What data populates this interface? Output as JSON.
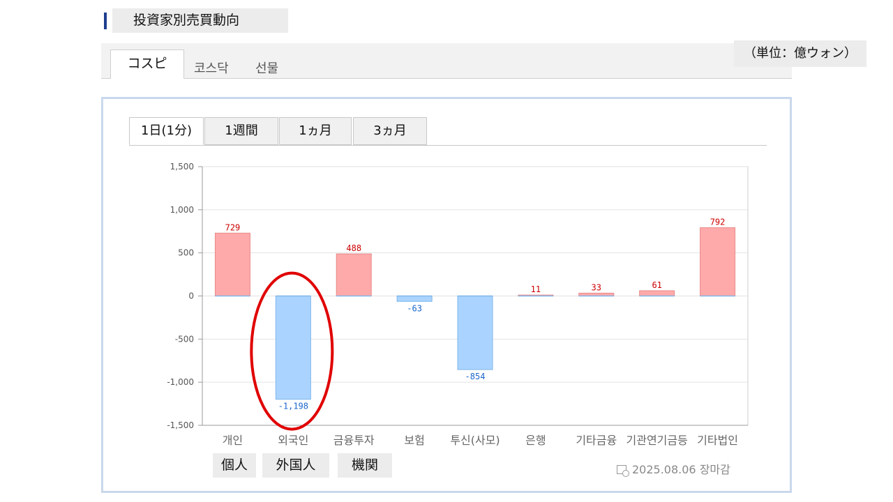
{
  "section": {
    "title": "投資家別売買動向"
  },
  "market_tabs": [
    {
      "label": "コスピ",
      "active": true
    },
    {
      "label": "코스닥",
      "active": false
    },
    {
      "label": "선물",
      "active": false
    }
  ],
  "unit": "（単位：億ウォン）",
  "period_tabs": [
    {
      "label": "1日(1分)",
      "active": true
    },
    {
      "label": "1週間",
      "active": false
    },
    {
      "label": "1ヵ月",
      "active": false
    },
    {
      "label": "3ヵ月",
      "active": false
    }
  ],
  "chart_data": {
    "type": "bar",
    "categories": [
      "개인",
      "외국인",
      "금융투자",
      "보험",
      "투신(사모)",
      "은행",
      "기타금융",
      "기관연기금등",
      "기타법인"
    ],
    "values": [
      729,
      -1198,
      488,
      -63,
      -854,
      11,
      33,
      61,
      792
    ],
    "data_labels": [
      "729",
      "-1,198",
      "488",
      "-63",
      "-854",
      "11",
      "33",
      "61",
      "792"
    ],
    "ylim": [
      -1500,
      1500
    ],
    "yticks": [
      1500,
      1000,
      500,
      0,
      -500,
      -1000,
      -1500
    ],
    "ytick_labels": [
      "1,500",
      "1,000",
      "500",
      "0",
      "-500",
      "-1,000",
      "-1,500"
    ],
    "grid": true,
    "positive_color": "#ffaaaa",
    "negative_color": "#aad4ff",
    "positive_label_color": "#cc0000",
    "negative_label_color": "#1a66cc",
    "highlighted_category": "외국인",
    "highlight_color": "#e00000"
  },
  "investor_labels_jp": [
    "個人",
    "外国人",
    "機関"
  ],
  "date_text": "2025.08.06 장마감"
}
